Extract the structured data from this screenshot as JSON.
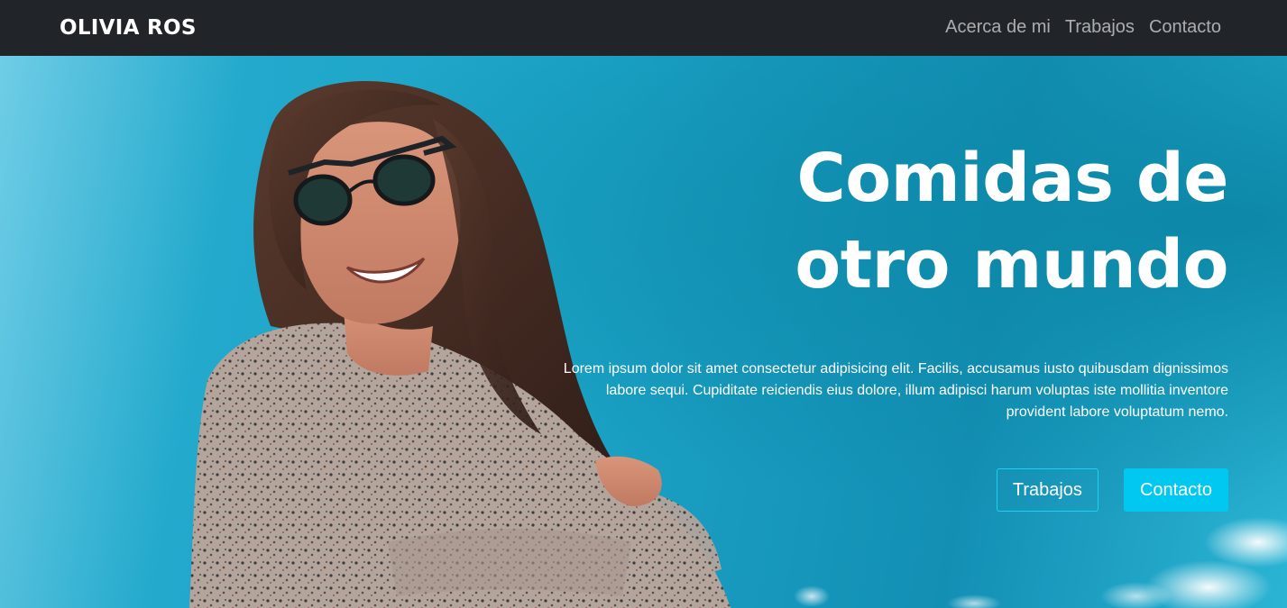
{
  "navbar": {
    "brand": "OLIVIA ROS",
    "links": [
      "Acerca de mi",
      "Trabajos",
      "Contacto"
    ],
    "background": "#212529"
  },
  "hero": {
    "title_line1": "Comidas de",
    "title_line2": "otro mundo",
    "text": "Lorem ipsum dolor sit amet consectetur adipisicing elit. Facilis, accusamus iusto quibusdam dignissimos labore sequi. Cupiditate reiciendis eius dolore, illum adipisci harum voluptas iste mollitia inventore provident labore voluptatum nemo.",
    "buttons": {
      "secondary": "Trabajos",
      "primary": "Contacto"
    },
    "accent_color": "#00c8f0",
    "sky_color": "#1ba3c6",
    "photo": "smiling-woman-sunglasses-photo"
  }
}
